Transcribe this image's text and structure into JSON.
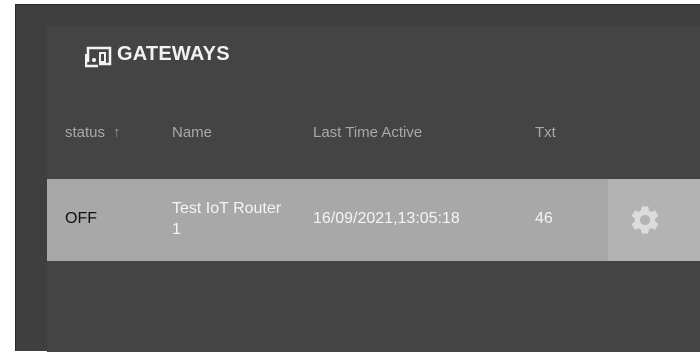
{
  "panel": {
    "title": "GATEWAYS",
    "title_icon": "gateway-router-icon"
  },
  "table": {
    "columns": [
      {
        "label": "status",
        "sort_indicator": "↑"
      },
      {
        "label": "Name"
      },
      {
        "label": "Last Time Active"
      },
      {
        "label": "Txt"
      }
    ],
    "rows": [
      {
        "status": "OFF",
        "name": "Test IoT Router 1",
        "last_active": "16/09/2021,13:05:18",
        "txt": "46",
        "action_icon": "gear-icon"
      }
    ]
  },
  "colors": {
    "background": "#3f3f3f",
    "panel": "#444444",
    "row_highlight": "#a8a8a8",
    "header_text": "#a9a9a9"
  }
}
